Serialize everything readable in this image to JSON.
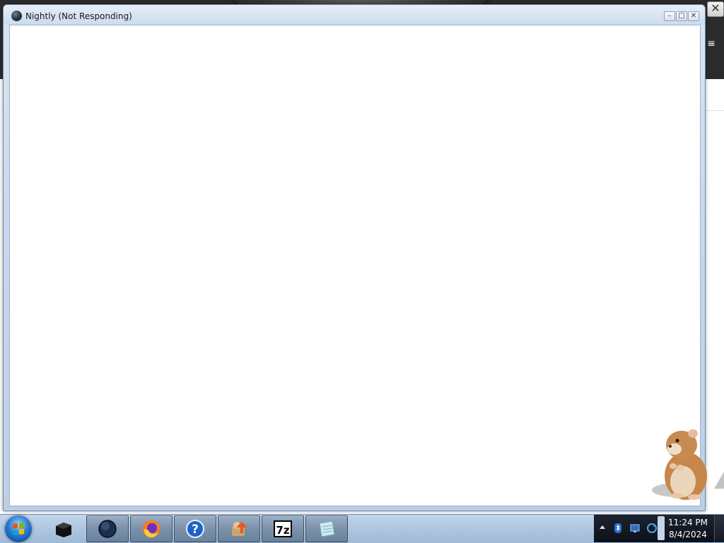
{
  "window": {
    "title": "Nightly (Not Responding)",
    "controls": {
      "minimize_glyph": "–",
      "maximize_glyph": "□",
      "close_glyph": "✕"
    }
  },
  "background_window": {
    "close_glyph": "✕",
    "menu_glyph": "≡"
  },
  "taskbar": {
    "start_button": "windows-start-orb",
    "pinned_items": [
      {
        "icon": "black-box-icon",
        "active": false
      },
      {
        "icon": "nightly-globe-icon",
        "active": true
      },
      {
        "icon": "firefox-icon",
        "active": true
      },
      {
        "icon": "help-icon",
        "active": true
      },
      {
        "icon": "installer-puzzle-icon",
        "active": true
      },
      {
        "icon": "7zip-icon",
        "active": true
      },
      {
        "icon": "notepad-icon",
        "active": true
      }
    ],
    "help_glyph": "?",
    "sevenzip_glyph": "7z"
  },
  "tray": {
    "icons": [
      "bluetooth-icon",
      "network-icon",
      "update-icon"
    ],
    "time": "11:24 PM",
    "date": "8/4/2024"
  },
  "colors": {
    "taskbar": "#aec6e0",
    "tray": "#12161f",
    "window_frame": "#c9d9ec",
    "client_bg": "#ffffff",
    "background_app": "#2b2b2b"
  }
}
